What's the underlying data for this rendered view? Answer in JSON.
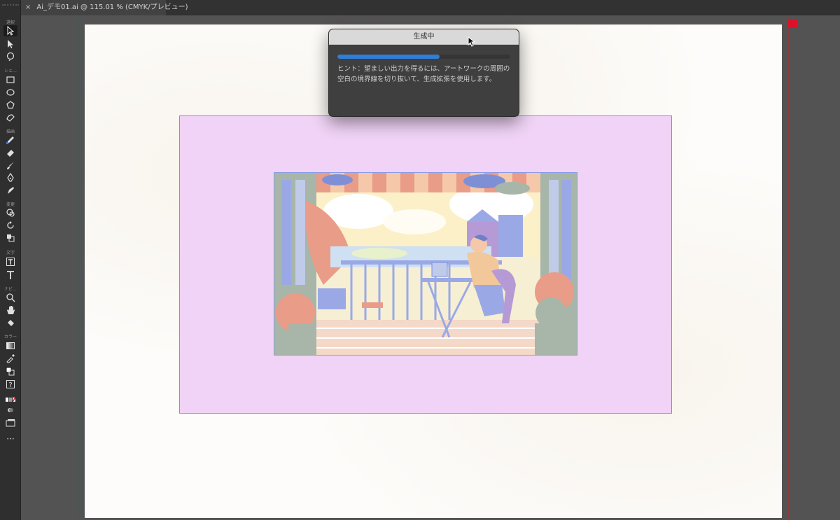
{
  "document_tab": {
    "close_label": "×",
    "title": "Ai_デモ01.ai @ 115.01 % (CMYK/プレビュー)"
  },
  "toolbar": {
    "sections": {
      "select": "選択",
      "shape": "シェ...",
      "draw": "描画",
      "modify": "変更",
      "type": "文字",
      "navigate": "ナビ...",
      "color": "カラー"
    },
    "tools": [
      "selection-tool",
      "direct-selection-tool",
      "lasso-tool",
      "rectangle-tool",
      "ellipse-tool",
      "polygon-tool",
      "shaper-tool",
      "pencil-tool",
      "eraser-tool",
      "paintbrush-tool",
      "pen-tool",
      "curvature-tool",
      "shape-builder-tool",
      "rotate-tool",
      "scale-tool",
      "type-tool",
      "type-tool-alt",
      "zoom-tool",
      "hand-tool",
      "live-paint-tool",
      "gradient-tool",
      "eyedropper-tool",
      "fill-stroke-swap",
      "help-tool",
      "color-swatches",
      "screen-mode",
      "draw-mode",
      "more-tools"
    ],
    "more_label": "···"
  },
  "dialog": {
    "title": "生成中",
    "progress": 0.59,
    "hint": "ヒント：望ましい出力を得るには、アートワークの周囲の空白の境界線を切り抜いて、生成拡張を使用します。"
  },
  "colors": {
    "generation_area": "#f0d3f6",
    "progress_accent": "#2f7ed8",
    "selection_outline": "#7b8fe8",
    "artboard": "#fdfcfa"
  }
}
